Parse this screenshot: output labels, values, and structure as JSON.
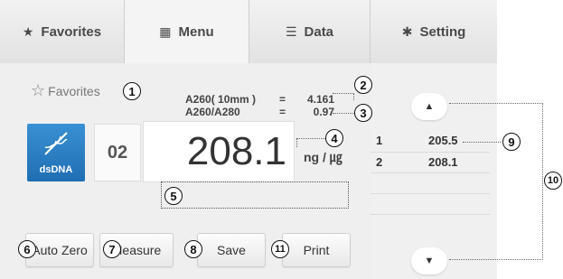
{
  "tabs": [
    {
      "label": "Favorites",
      "icon": "star-icon"
    },
    {
      "label": "Menu",
      "icon": "grid-icon"
    },
    {
      "label": "Data",
      "icon": "list-icon"
    },
    {
      "label": "Setting",
      "icon": "gear-icon"
    }
  ],
  "active_tab": "Menu",
  "favorites_label": "Favorites",
  "ratios": [
    {
      "label": "A260( 10mm )",
      "eq": "=",
      "value": "4.161"
    },
    {
      "label": "A260/A280",
      "eq": "=",
      "value": "0.97"
    }
  ],
  "sample_type": "dsDNA",
  "sample_number": "02",
  "reading": {
    "value": "208.1",
    "unit": "ng / ㎍"
  },
  "buttons": {
    "auto_zero": "Auto Zero",
    "measure": "Measure",
    "save": "Save",
    "print": "Print"
  },
  "results": [
    {
      "n": "1",
      "value": "205.5"
    },
    {
      "n": "2",
      "value": "208.1"
    }
  ],
  "callouts": [
    "1",
    "2",
    "3",
    "4",
    "5",
    "6",
    "7",
    "8",
    "9",
    "10",
    "11"
  ],
  "colors": {
    "dsdna_blue": "#2a7fc6",
    "panel_bg": "#efefef",
    "tab_bg": "#e6e6e6"
  }
}
